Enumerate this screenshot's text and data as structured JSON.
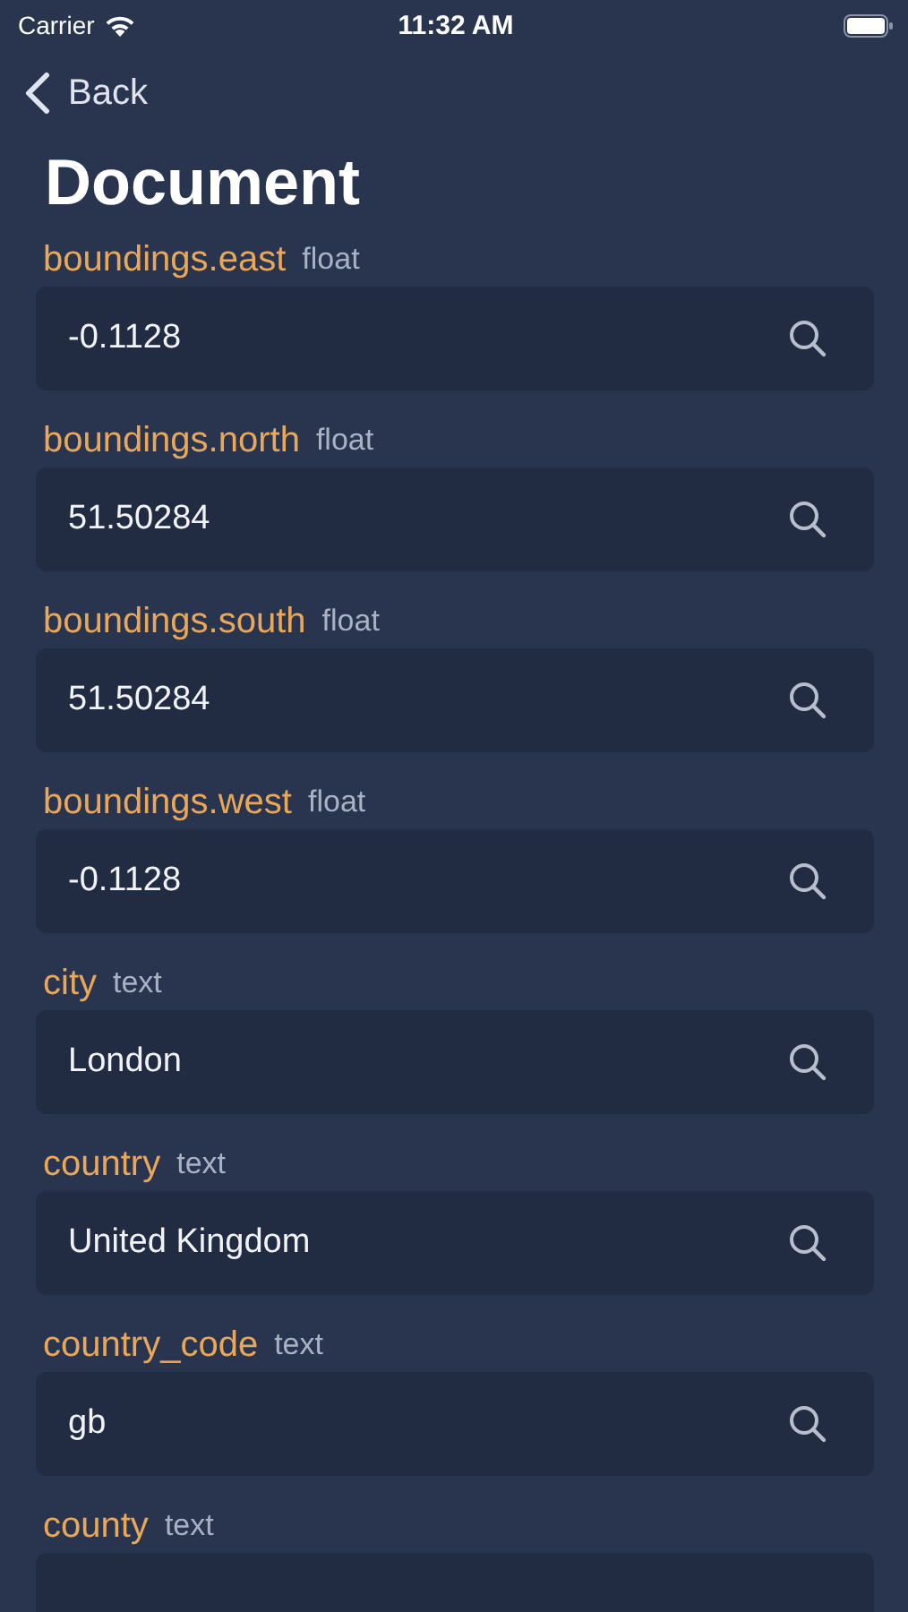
{
  "status_bar": {
    "carrier": "Carrier",
    "time": "11:32 AM"
  },
  "nav": {
    "back": "Back"
  },
  "title": "Document",
  "fields": [
    {
      "name": "boundings.east",
      "type": "float",
      "value": "-0.1128"
    },
    {
      "name": "boundings.north",
      "type": "float",
      "value": "51.50284"
    },
    {
      "name": "boundings.south",
      "type": "float",
      "value": "51.50284"
    },
    {
      "name": "boundings.west",
      "type": "float",
      "value": "-0.1128"
    },
    {
      "name": "city",
      "type": "text",
      "value": "London"
    },
    {
      "name": "country",
      "type": "text",
      "value": "United Kingdom"
    },
    {
      "name": "country_code",
      "type": "text",
      "value": "gb"
    },
    {
      "name": "county",
      "type": "text"
    }
  ]
}
